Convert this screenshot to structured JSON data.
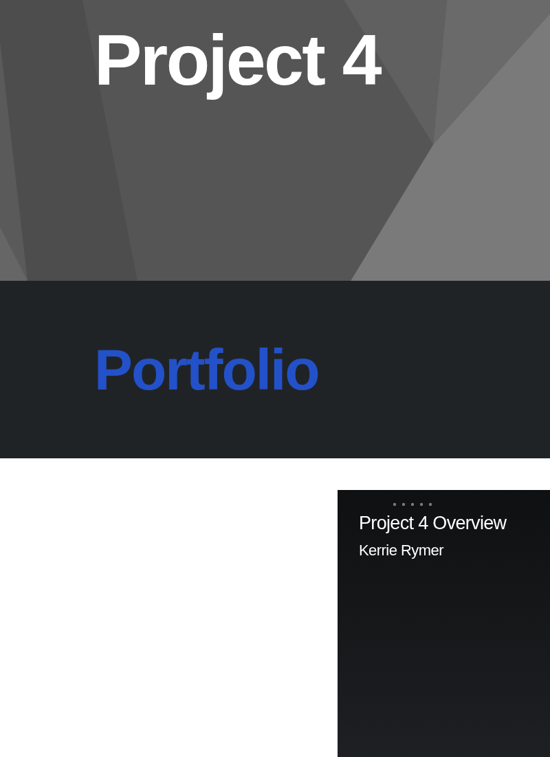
{
  "hero": {
    "title": "Project 4",
    "kind": "picture"
  },
  "section": {
    "heading": "Portfolio"
  },
  "video": {
    "title": "Project 4 Overview",
    "author": "Kerrie Rymer"
  }
}
